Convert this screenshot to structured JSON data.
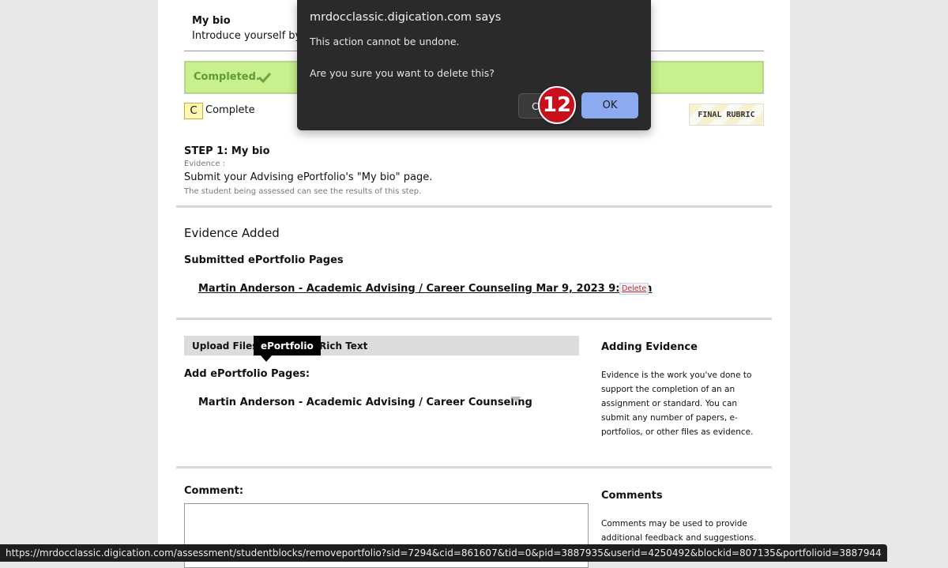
{
  "dialog": {
    "title": "mrdocclassic.digication.com says",
    "line1": "This action cannot be undone.",
    "line2": "Are you sure you want to delete this?",
    "cancel_label": "Cancel",
    "ok_label": "OK",
    "step_badge": "12"
  },
  "bio": {
    "title": "My bio",
    "subtitle": "Introduce yourself by"
  },
  "status_block": {
    "completed_label": "Completed.",
    "grade_letter": "C",
    "grade_label": "Complete",
    "rubric_button": "FINAL RUBRIC"
  },
  "step": {
    "title": "STEP 1: My bio",
    "evidence_label": "Evidence :",
    "instruction": "Submit your Advising ePortfolio's \"My bio\" page.",
    "visibility_note": "The student being assessed can see the results of this step."
  },
  "evidence_added": {
    "heading": "Evidence Added",
    "subheading": "Submitted ePortfolio Pages",
    "item_link": "Martin Anderson - Academic Advising / Career Counseling Mar 9, 2023 9:28pm",
    "delete_label": "Delete"
  },
  "add_evidence": {
    "tabs": [
      "Upload Files",
      "ePortfolio",
      "Rich Text"
    ],
    "active_tab": "ePortfolio",
    "add_pages_label": "Add ePortfolio Pages:",
    "selected_portfolio": "Martin Anderson - Academic Advising / Career Counseling",
    "side_title": "Adding Evidence",
    "side_text": "Evidence is the work you've done to support the completion of an an assignment or standard. You can submit any number of papers, e-portfolios, or other files as evidence."
  },
  "comments": {
    "label": "Comment:",
    "side_title": "Comments",
    "side_text": "Comments may be used to provide additional feedback and suggestions."
  },
  "status_bar": {
    "url": "https://mrdocclassic.digication.com/assessment/studentblocks/removeportfolio?sid=7294&cid=861607&tid=0&pid=3887935&userid=4250492&blockid=807135&portfolioid=3887944"
  },
  "colors": {
    "completed_bg": "#c8f08c",
    "completed_text": "#5e9a3a",
    "ok_button": "#8caaf0",
    "badge": "#c8101c",
    "dialog_bg": "#2a2a2c"
  }
}
